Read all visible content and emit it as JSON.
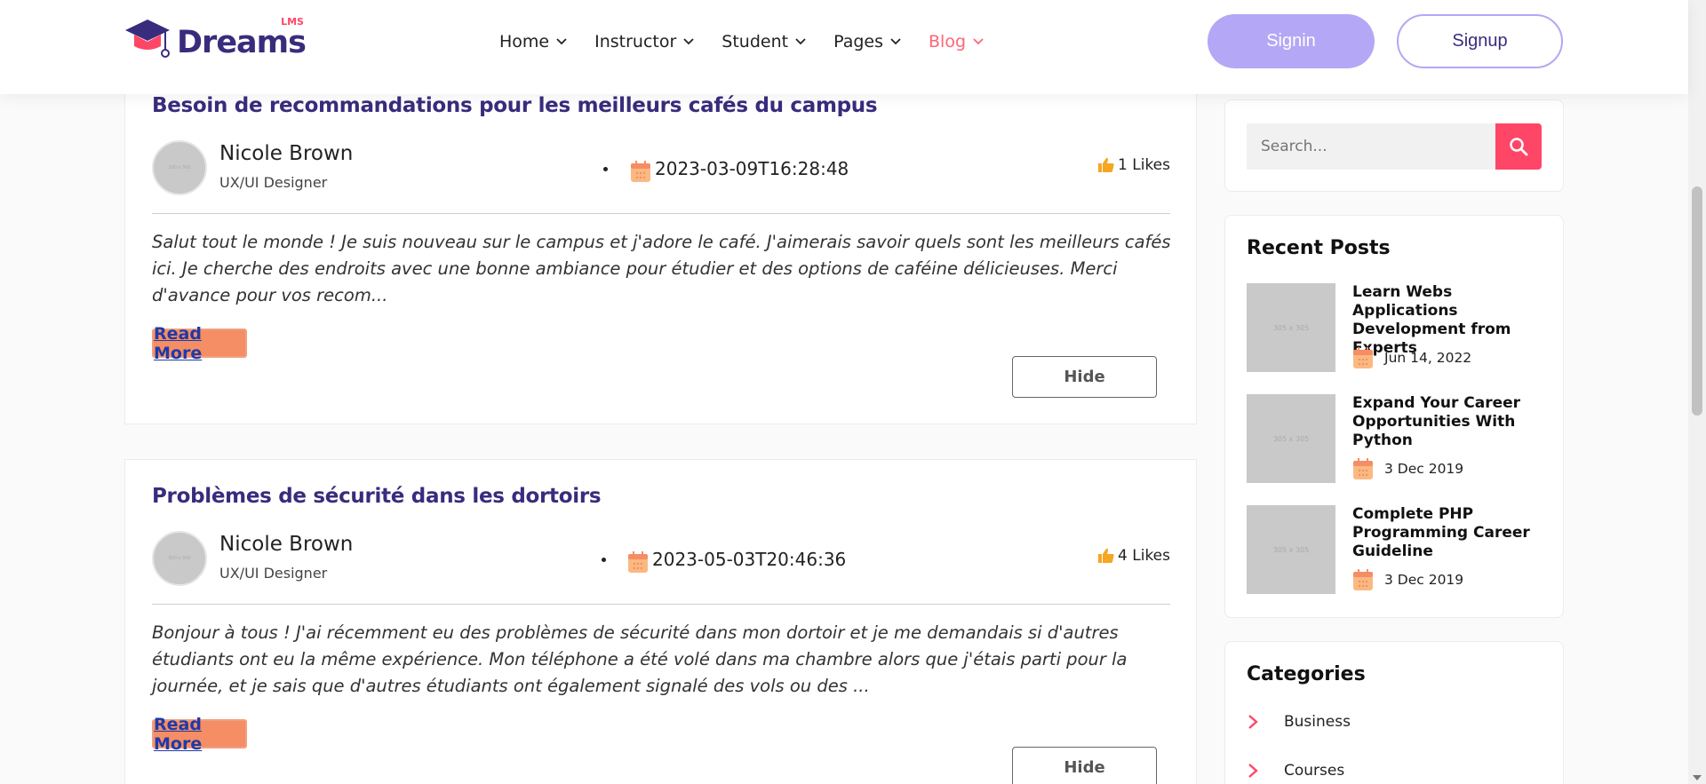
{
  "header": {
    "logo_text": "Dreams",
    "logo_sup": "LMS",
    "nav": [
      {
        "label": "Home"
      },
      {
        "label": "Instructor"
      },
      {
        "label": "Student"
      },
      {
        "label": "Pages"
      },
      {
        "label": "Blog"
      }
    ],
    "signin_label": "Signin",
    "signup_label": "Signup",
    "colors": {
      "brand": "#392c7d",
      "accent": "#ff4667",
      "signin_bg": "#b4a7f5"
    }
  },
  "posts": [
    {
      "title": "Besoin de recommandations pour les meilleurs cafés du campus",
      "author": "Nicole Brown",
      "role": "UX/UI Designer",
      "avatar_placeholder": "300 x 300",
      "date": "2023-03-09T16:28:48",
      "likes": "1 Likes",
      "body": "Salut tout le monde ! Je suis nouveau sur le campus et j'adore le café. J'aimerais savoir quels sont les meilleurs cafés ici. Je cherche des endroits avec une bonne ambiance pour étudier et des options de caféine délicieuses. Merci d'avance pour vos recom...",
      "read_more": "Read More",
      "hide": "Hide"
    },
    {
      "title": "Problèmes de sécurité dans les dortoirs",
      "author": "Nicole Brown",
      "role": "UX/UI Designer",
      "avatar_placeholder": "300 x 300",
      "date": "2023-05-03T20:46:36",
      "likes": "4 Likes",
      "body": "Bonjour à tous ! J'ai récemment eu des problèmes de sécurité dans mon dortoir et je me demandais si d'autres étudiants ont eu la même expérience. Mon téléphone a été volé dans ma chambre alors que j'étais parti pour la journée, et je sais que d'autres étudiants ont également signalé des vols ou des ...",
      "read_more": "Read More",
      "hide": "Hide"
    }
  ],
  "sidebar": {
    "search_placeholder": "Search...",
    "recent_title": "Recent Posts",
    "recent_posts": [
      {
        "title": "Learn Webs Applications Development from Experts",
        "date": "Jun 14, 2022",
        "thumb": "305 x 305"
      },
      {
        "title": "Expand Your Career Opportunities With Python",
        "date": "3 Dec 2019",
        "thumb": "305 x 305"
      },
      {
        "title": "Complete PHP Programming Career Guideline",
        "date": "3 Dec 2019",
        "thumb": "305 x 305"
      }
    ],
    "categories_title": "Categories",
    "categories": [
      {
        "label": "Business"
      },
      {
        "label": "Courses"
      }
    ]
  }
}
